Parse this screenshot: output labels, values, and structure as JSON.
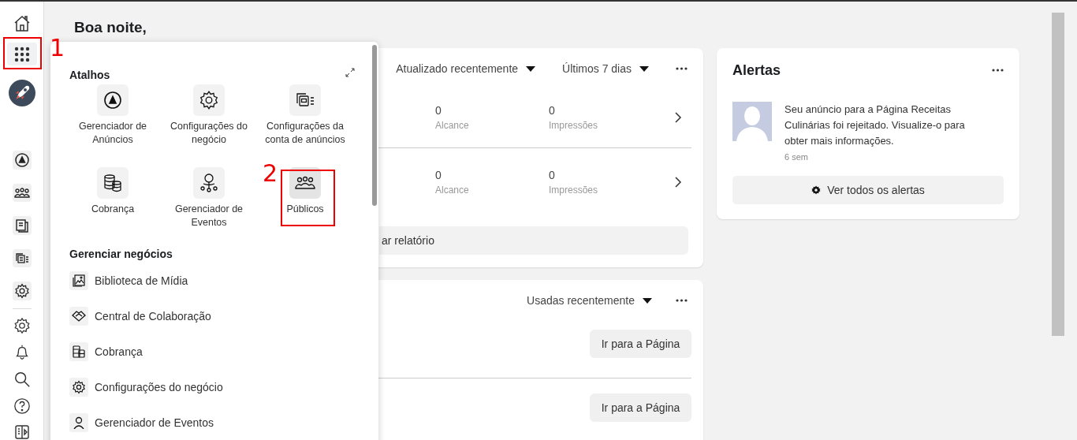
{
  "rail": {
    "annotation": "1"
  },
  "greeting": "Boa noite,",
  "shortcuts_panel": {
    "title": "Atalhos",
    "shortcuts": [
      {
        "label": "Gerenciador de Anúncios",
        "highlighted": false
      },
      {
        "label": "Configurações do negócio",
        "highlighted": false
      },
      {
        "label": "Configurações da conta de anúncios",
        "highlighted": false
      },
      {
        "label": "Cobrança",
        "highlighted": false
      },
      {
        "label": "Gerenciador de Eventos",
        "highlighted": false
      },
      {
        "label": "Públicos",
        "highlighted": true,
        "annotation": "2"
      }
    ],
    "section_title": "Gerenciar negócios",
    "items": [
      {
        "label": "Biblioteca de Mídia"
      },
      {
        "label": "Central de Colaboração"
      },
      {
        "label": "Cobrança"
      },
      {
        "label": "Configurações do negócio"
      },
      {
        "label": "Gerenciador de Eventos"
      }
    ]
  },
  "performance_card": {
    "sort": "Atualizado recentemente",
    "period": "Últimos 7 dias",
    "rows": [
      {
        "metrics": [
          {
            "value": "0",
            "label": "Alcance"
          },
          {
            "value": "0",
            "label": "Impressões"
          }
        ]
      },
      {
        "metrics": [
          {
            "value": "0",
            "label": "Alcance"
          },
          {
            "value": "0",
            "label": "Impressões"
          }
        ]
      }
    ],
    "report_button": "ar relatório"
  },
  "pages_card": {
    "sort": "Usadas recentemente",
    "buttons": [
      "Ir para a Página",
      "Ir para a Página"
    ]
  },
  "alerts": {
    "title": "Alertas",
    "items": [
      {
        "message": "Seu anúncio para a Página Receitas Culinárias foi rejeitado. Visualize-o para obter mais informações.",
        "time": "6 sem"
      }
    ],
    "button": "Ver todos os alertas"
  }
}
